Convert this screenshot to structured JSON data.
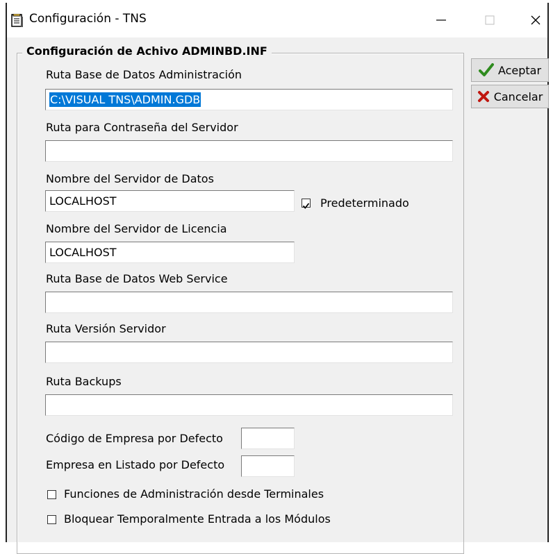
{
  "window": {
    "title": "Configuración - TNS"
  },
  "group": {
    "title": "Configuración de Achivo ADMINBD.INF"
  },
  "fields": {
    "ruta_base": {
      "label": "Ruta Base de Datos Administración",
      "value": "C:\\VISUAL TNS\\ADMIN.GDB"
    },
    "ruta_contrasena": {
      "label": "Ruta para Contraseña del Servidor",
      "value": ""
    },
    "servidor_datos": {
      "label": "Nombre del Servidor de Datos",
      "value": "LOCALHOST"
    },
    "servidor_licencia": {
      "label": "Nombre del Servidor de Licencia",
      "value": "LOCALHOST"
    },
    "web_service": {
      "label": "Ruta Base de Datos Web Service",
      "value": ""
    },
    "version_servidor": {
      "label": "Ruta Versión Servidor",
      "value": ""
    },
    "backups": {
      "label": "Ruta Backups",
      "value": ""
    },
    "codigo_empresa": {
      "label": "Código de Empresa por Defecto",
      "value": ""
    },
    "empresa_listado": {
      "label": "Empresa en Listado por Defecto",
      "value": ""
    }
  },
  "checks": {
    "predeterminado": {
      "label": "Predeterminado",
      "checked": true
    },
    "funciones_admin": {
      "label": "Funciones de Administración desde Terminales",
      "checked": false
    },
    "bloquear": {
      "label": "Bloquear Temporalmente Entrada a los Módulos",
      "checked": false
    }
  },
  "buttons": {
    "aceptar": "Aceptar",
    "cancelar": "Cancelar"
  },
  "colors": {
    "selection": "#0078d7",
    "accept_icon": "#2e8b1e",
    "cancel_icon": "#c0160e"
  },
  "icons": {
    "app": "document-icon",
    "accept": "checkmark-icon",
    "cancel": "x-icon"
  }
}
